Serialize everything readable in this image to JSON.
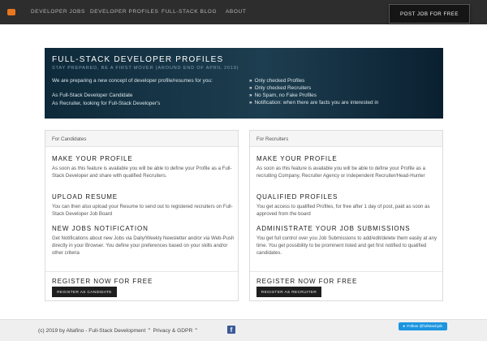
{
  "nav": {
    "links": [
      "DEVELOPER JOBS",
      "DEVELOPER PROFILES",
      "FULL-STACK BLOG",
      "ABOUT"
    ],
    "post_job": "POST JOB FOR FREE"
  },
  "hero": {
    "title": "FULL-STACK DEVELOPER PROFILES",
    "subtitle": "STAY PREPARED, BE A FIRST MOVER (AROUND END OF APRIL 2019)",
    "intro": "We are preparing a new concept of developer profile/resumes for you:",
    "audiences": [
      "As Full-Stack Developer Candidate",
      "As Recruiter, looking for Full-Stack Developer's"
    ],
    "bullets": [
      "Only checked Profiles",
      "Only checked Recruiters",
      "No Spam, no Fake Profiles",
      "Notification: when there are facts you are interested in"
    ]
  },
  "candidates": {
    "header": "For Candidates",
    "sections": [
      {
        "title": "MAKE YOUR PROFILE",
        "text": "As soon as this feature is available you will be able to define your Profile as a Full-Stack Developer and share with qualified Recruiters."
      },
      {
        "title": "UPLOAD RESUME",
        "text": "You can then also upload your Resume to send out to registered recruiters on Full-Stack Developer Job Board"
      },
      {
        "title": "NEW JOBS NOTIFICATION",
        "text": "Get Notifications about new Jobs via Daily/Weekly Newsletter and/or via Web-Push directly in your Browser. You define your preferences based on your skills and/or other criteria"
      }
    ],
    "register_title": "REGISTER NOW FOR FREE",
    "register_button": "REGISTER AS CANDIDATE"
  },
  "recruiters": {
    "header": "For Recruiters",
    "sections": [
      {
        "title": "MAKE YOUR PROFILE",
        "text": "As soon as this feature is available you will be able to define your Profile as a recruiting Company, Recruiter Agency or independent Recruiter/Head-Hunter"
      },
      {
        "title": "QUALIFIED PROFILES",
        "text": "You get access to qualified Profiles, for free after 1 day of post, paid as soon as approved from the board"
      },
      {
        "title": "ADMINISTRATE YOUR JOB SUBMISSIONS",
        "text": "You get full control over you Job Submissions to add/edit/delete them easily at any time. You get possibility to be prominent listed and get first notified to qualified candidates."
      }
    ],
    "register_title": "REGISTER NOW FOR FREE",
    "register_button": "REGISTER AS RECRUITER"
  },
  "footer": {
    "text": "(c) 2019 by Altafino - Full-Stack Development ⌃ Privacy & GDPR ⌃",
    "twitter": "Follow @fullstackjob"
  },
  "colors": {
    "navbar": "#2d2d2d",
    "hero": "#1d3e50",
    "facebook": "#3b5998",
    "twitter": "#1b95e0"
  },
  "icons": [
    "logo-icon",
    "chevron-bullet-icon",
    "facebook-icon",
    "twitter-icon"
  ]
}
